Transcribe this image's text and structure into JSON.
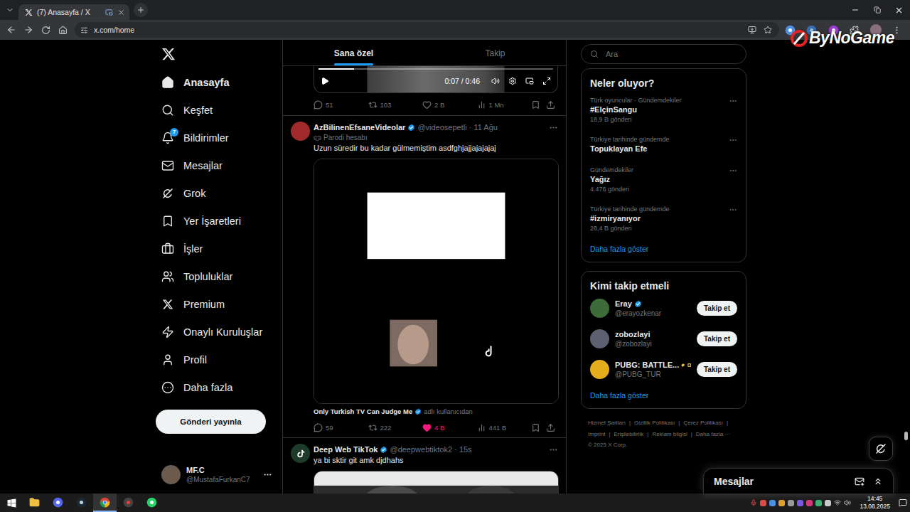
{
  "browser": {
    "tab": {
      "title": "(7) Anasayfa / X",
      "selected": true
    },
    "url": "x.com/home"
  },
  "watermark": "ByNoGame",
  "nav": {
    "items": [
      {
        "label": "Anasayfa",
        "selected": true
      },
      {
        "label": "Keşfet",
        "selected": false
      },
      {
        "label": "Bildirimler",
        "selected": false,
        "badge": "7"
      },
      {
        "label": "Mesajlar",
        "selected": false
      },
      {
        "label": "Grok",
        "selected": false
      },
      {
        "label": "Yer İşaretleri",
        "selected": false
      },
      {
        "label": "İşler",
        "selected": false
      },
      {
        "label": "Topluluklar",
        "selected": false
      },
      {
        "label": "Premium",
        "selected": false
      },
      {
        "label": "Onaylı Kuruluşlar",
        "selected": false
      },
      {
        "label": "Profil",
        "selected": false
      },
      {
        "label": "Daha fazla",
        "selected": false
      }
    ],
    "post_button": "Gönderi yayınla",
    "account": {
      "name": "MF.C",
      "handle": "@MustafaFurkanC7",
      "color": "#6b5a4e"
    }
  },
  "feed": {
    "tabs": [
      {
        "label": "Sana özel",
        "selected": true
      },
      {
        "label": "Takip",
        "selected": false
      }
    ],
    "separator": "·",
    "previous": {
      "video": {
        "time": "0:07 / 0:46",
        "level": 0.15
      },
      "stats": {
        "replies": "51",
        "reposts": "103",
        "likes": "2 B",
        "views": "1 Mn",
        "liked": false
      }
    },
    "posts": [
      {
        "author": "AzBilinenEfsaneVideolar",
        "verified": true,
        "handle": "@videosepetli",
        "date": "11 Ağu",
        "color": "#a02a2a",
        "label": "Parodi hesabı",
        "text": "Uzun süredir bu kadar gülmemiştim asdfghjajjajajajaj",
        "attribution": {
          "name": "Only Turkish TV Can Judge Me",
          "verified": true,
          "suffix": "adlı kullanıcıdan"
        },
        "stats": {
          "replies": "59",
          "reposts": "222",
          "likes": "4 B",
          "views": "441 B",
          "liked": true
        }
      },
      {
        "author": "Deep Web TikTok",
        "verified": true,
        "handle": "@deepwebtiktok2",
        "date": "15s",
        "color": "#1e3b2a",
        "text": "ya bi sktir git amk djdhahs"
      }
    ]
  },
  "sidebar": {
    "search": {
      "placeholder": "Ara"
    },
    "trends": {
      "title": "Neler oluyor?",
      "items": [
        {
          "context": "Türk oyuncular · Gündemdekiler",
          "name": "#ElçinSangu",
          "count": "18,9 B gönderi"
        },
        {
          "context": "Türkiye tarihinde gündemde",
          "name": "Topuklayan Efe"
        },
        {
          "context": "Gündemdekiler",
          "name": "Yağız",
          "count": "4.476 gönderi"
        },
        {
          "context": "Türkiye tarihinde gündemde",
          "name": "#izmiryanıyor",
          "count": "28,4 B gönderi"
        }
      ],
      "more": "Daha fazla göster"
    },
    "follow": {
      "title": "Kimi takip etmeli",
      "button": "Takip et",
      "items": [
        {
          "name": "Eray",
          "handle": "@erayozkenar",
          "check": "blue",
          "affiliate": false,
          "color": "#3d6b3a"
        },
        {
          "name": "zobozlayi",
          "handle": "@zobozlayi",
          "check": "none",
          "affiliate": false,
          "color": "#5d6070"
        },
        {
          "name": "PUBG: BATTLE...",
          "handle": "@PUBG_TUR",
          "check": "gold",
          "affiliate": true,
          "color": "#e3ac1c"
        }
      ],
      "more": "Daha fazla göster"
    },
    "footer": {
      "links": [
        "Hizmet Şartları",
        "Gizlilik Politikası",
        "Çerez Politikası",
        "Imprint",
        "Erişilebilirlik",
        "Reklam bilgisi"
      ],
      "separator": "|",
      "more": "Daha fazla ···",
      "copyright": "© 2025 X Corp."
    }
  },
  "messages": {
    "title": "Mesajlar"
  },
  "scrollbar": {
    "level": 0.88
  },
  "taskbar": {
    "apps": [
      {
        "selected": false
      },
      {
        "selected": false
      },
      {
        "selected": false
      },
      {
        "selected": true
      },
      {
        "selected": false
      },
      {
        "selected": false
      }
    ],
    "time": "14:45",
    "date": "13.08.2025"
  }
}
